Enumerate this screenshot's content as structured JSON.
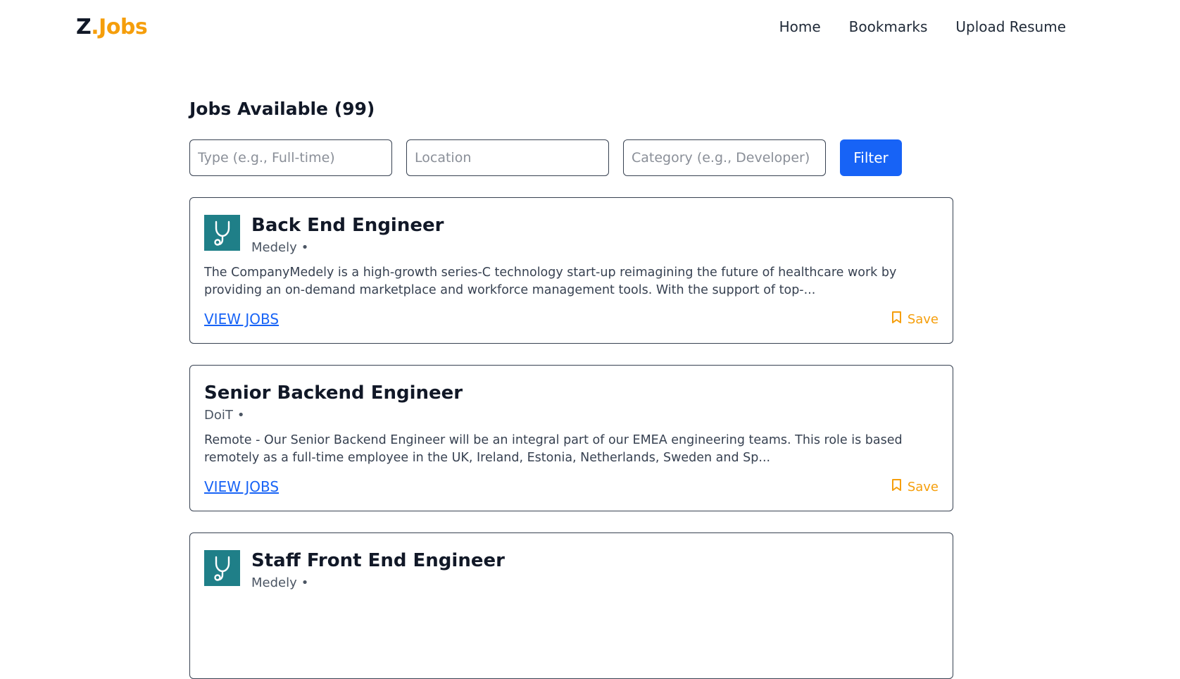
{
  "nav": {
    "logo_prefix": "Z",
    "logo_suffix": ".Jobs",
    "links": [
      "Home",
      "Bookmarks",
      "Upload Resume"
    ]
  },
  "main": {
    "title": "Jobs Available (99)",
    "filters": {
      "type_placeholder": "Type (e.g., Full-time)",
      "location_placeholder": "Location",
      "category_placeholder": "Category (e.g., Developer)",
      "button_label": "Filter"
    },
    "jobs": [
      {
        "title": "Back End Engineer",
        "company": "Medely",
        "dot": "•",
        "logo": "stethoscope-icon",
        "description": "The CompanyMedely is a high-growth series-C technology start-up reimagining the future of healthcare work by providing an on-demand marketplace and workforce management tools. With the support of top-...",
        "link_label": "VIEW JOBS",
        "save_label": "Save"
      },
      {
        "title": "Senior Backend Engineer",
        "company": "DoiT",
        "dot": "•",
        "logo": "",
        "description": "Remote - Our Senior Backend Engineer will be an integral part of our EMEA engineering teams. This role is based remotely as a full-time employee in the UK, Ireland, Estonia, Netherlands, Sweden and Sp...",
        "link_label": "VIEW JOBS",
        "save_label": "Save"
      },
      {
        "title": "Staff Front End Engineer",
        "company": "Medely",
        "dot": "•",
        "logo": "stethoscope-icon",
        "description": "",
        "link_label": "",
        "save_label": ""
      }
    ]
  },
  "colors": {
    "brand_accent": "#f59e0b",
    "primary_button": "#1763f6",
    "link": "#1763f6",
    "logo_bg": "#1f7f88"
  }
}
